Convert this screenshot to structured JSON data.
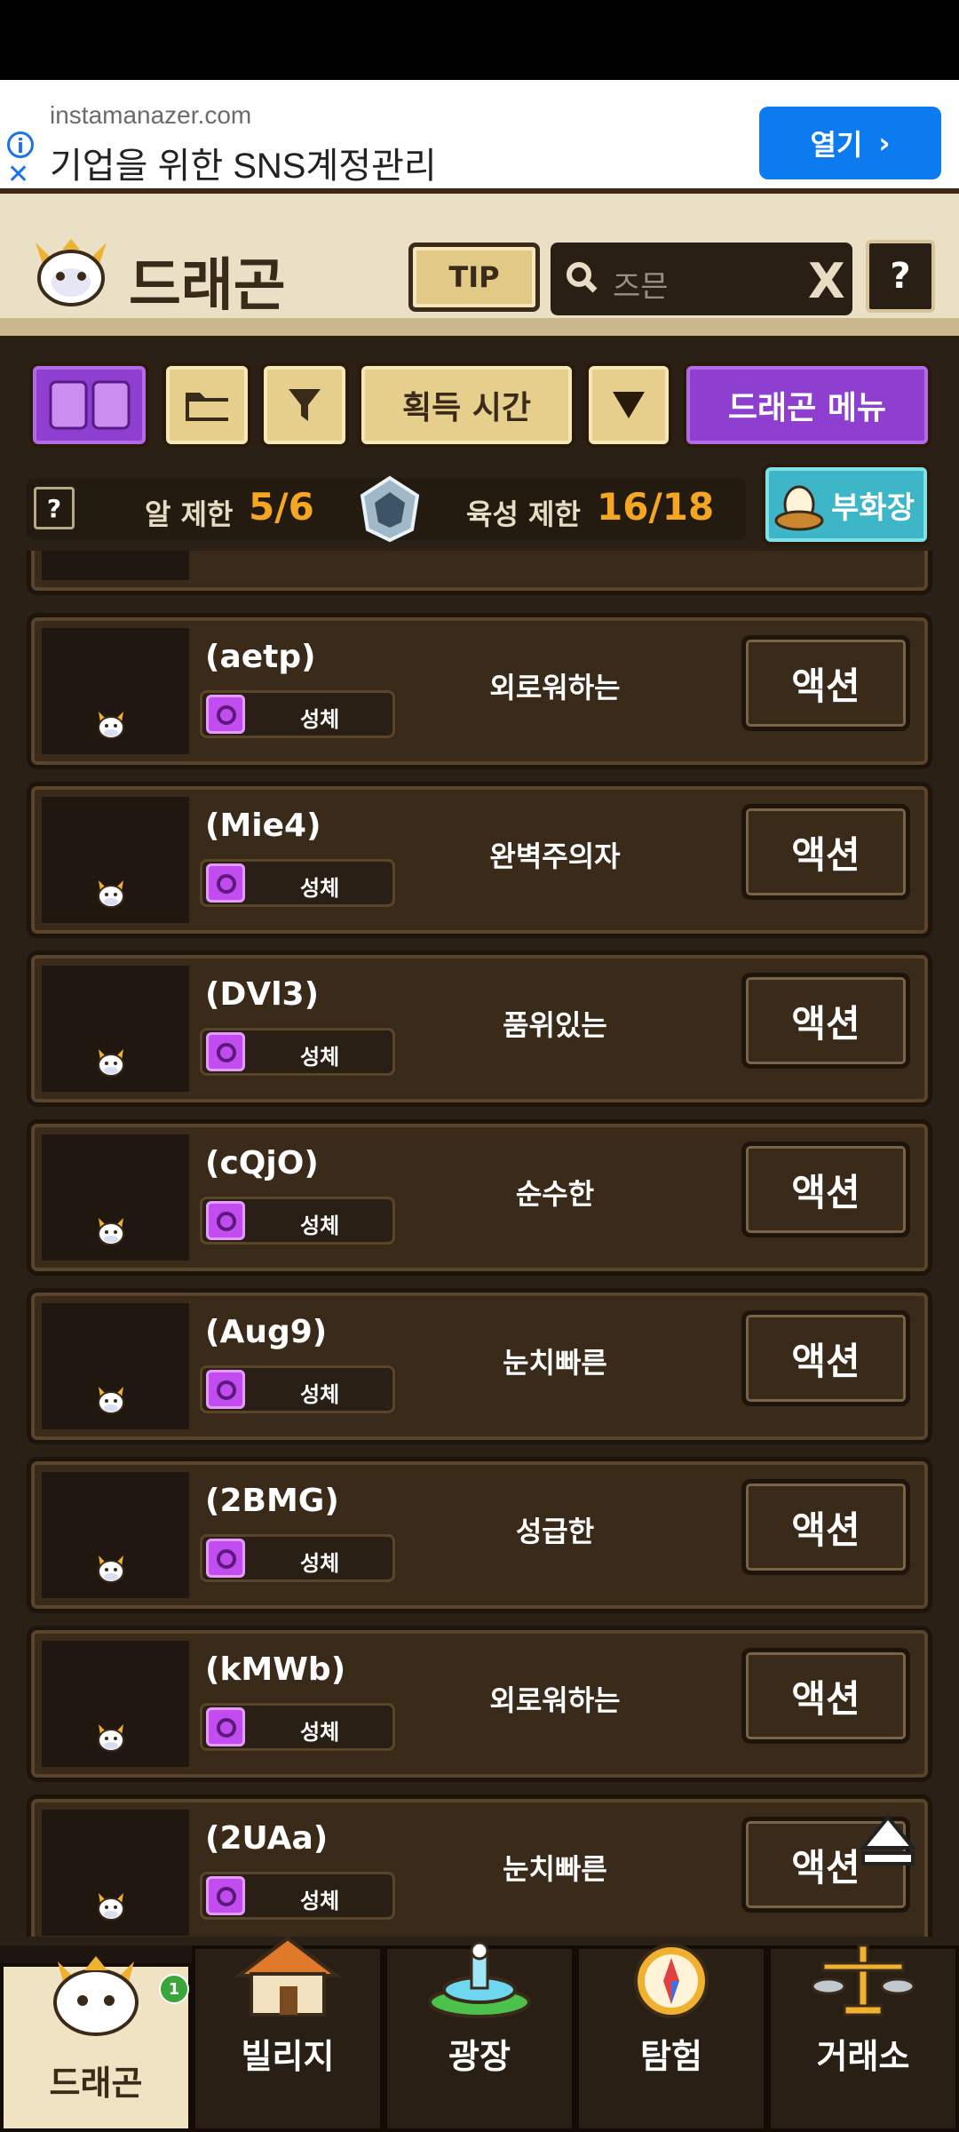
{
  "ad": {
    "domain": "instamanazer.com",
    "headline": "기업을 위한 SNS계정관리",
    "open_label": "열기",
    "info_icon": "info-icon",
    "close_icon": "close-icon"
  },
  "header": {
    "title": "드래곤",
    "tip_label": "TIP",
    "search_placeholder": "즈믄",
    "clear_label": "X",
    "help_label": "?"
  },
  "toolbar": {
    "view_icon": "grid-view-icon",
    "folder_icon": "folder-icon",
    "filter_icon": "filter-icon",
    "sort_label": "획득 시간",
    "sort_dir_icon": "triangle-down-icon",
    "menu_label": "드래곤 메뉴"
  },
  "limits": {
    "help_label": "?",
    "egg_label": "알 제한",
    "egg_value": "5/6",
    "raise_label": "육성 제한",
    "raise_value": "16/18",
    "hatchery_label": "부화장"
  },
  "dragons": [
    {
      "name": "(aetp)",
      "stage": "성체",
      "personality": "외로워하는",
      "action": "액션"
    },
    {
      "name": "(Mie4)",
      "stage": "성체",
      "personality": "완벽주의자",
      "action": "액션"
    },
    {
      "name": "(DVl3)",
      "stage": "성체",
      "personality": "품위있는",
      "action": "액션"
    },
    {
      "name": "(cQjO)",
      "stage": "성체",
      "personality": "순수한",
      "action": "액션"
    },
    {
      "name": "(Aug9)",
      "stage": "성체",
      "personality": "눈치빠른",
      "action": "액션"
    },
    {
      "name": "(2BMG)",
      "stage": "성체",
      "personality": "성급한",
      "action": "액션"
    },
    {
      "name": "(kMWb)",
      "stage": "성체",
      "personality": "외로워하는",
      "action": "액션"
    },
    {
      "name": "(2UAa)",
      "stage": "성체",
      "personality": "눈치빠른",
      "action": "액션"
    }
  ],
  "nav": {
    "tabs": [
      {
        "label": "드래곤",
        "badge": "1"
      },
      {
        "label": "빌리지"
      },
      {
        "label": "광장"
      },
      {
        "label": "탐험"
      },
      {
        "label": "거래소"
      }
    ]
  },
  "colors": {
    "accent_purple": "#8f3fcf",
    "accent_beige": "#e6cf8d",
    "value_orange": "#f5a623",
    "ad_button": "#0b7bef"
  }
}
